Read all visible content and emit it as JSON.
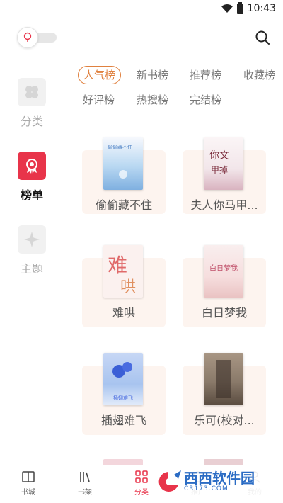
{
  "status_bar": {
    "time": "10:43"
  },
  "left_nav": [
    {
      "label": "分类",
      "icon": "clover-icon",
      "active": false
    },
    {
      "label": "榜单",
      "icon": "award-ribbon-icon",
      "active": true
    },
    {
      "label": "主题",
      "icon": "diamond-star-icon",
      "active": false
    }
  ],
  "tabs": [
    {
      "label": "人气榜",
      "active": true
    },
    {
      "label": "新书榜"
    },
    {
      "label": "推荐榜"
    },
    {
      "label": "收藏榜"
    },
    {
      "label": "好评榜"
    },
    {
      "label": "热搜榜"
    },
    {
      "label": "完结榜"
    }
  ],
  "books": [
    {
      "title": "偷偷藏不住",
      "cover_color": "#b9d8f2"
    },
    {
      "title": "夫人你马甲...",
      "cover_color": "#f2e6ea"
    },
    {
      "title": "难哄",
      "cover_color": "#fbf1ef"
    },
    {
      "title": "白日梦我",
      "cover_color": "#f6dede"
    },
    {
      "title": "插翅难飞",
      "cover_color": "#a8c4ef"
    },
    {
      "title": "乐可(校对...",
      "cover_color": "#8a7a6a"
    }
  ],
  "bottom_nav": [
    {
      "label": "书城",
      "icon": "book-open-icon"
    },
    {
      "label": "书架",
      "icon": "bookshelf-icon"
    },
    {
      "label": "分类",
      "icon": "category-grid-icon",
      "active": true
    },
    {
      "label": "推广",
      "icon": "share-icon"
    },
    {
      "label": "我的",
      "icon": "user-icon"
    }
  ],
  "watermark": {
    "name": "西西软件园",
    "site": "CR173.COM"
  },
  "colors": {
    "accent": "#e8344a",
    "tab_accent": "#e0813f",
    "card_bg": "#fdf4ef"
  }
}
